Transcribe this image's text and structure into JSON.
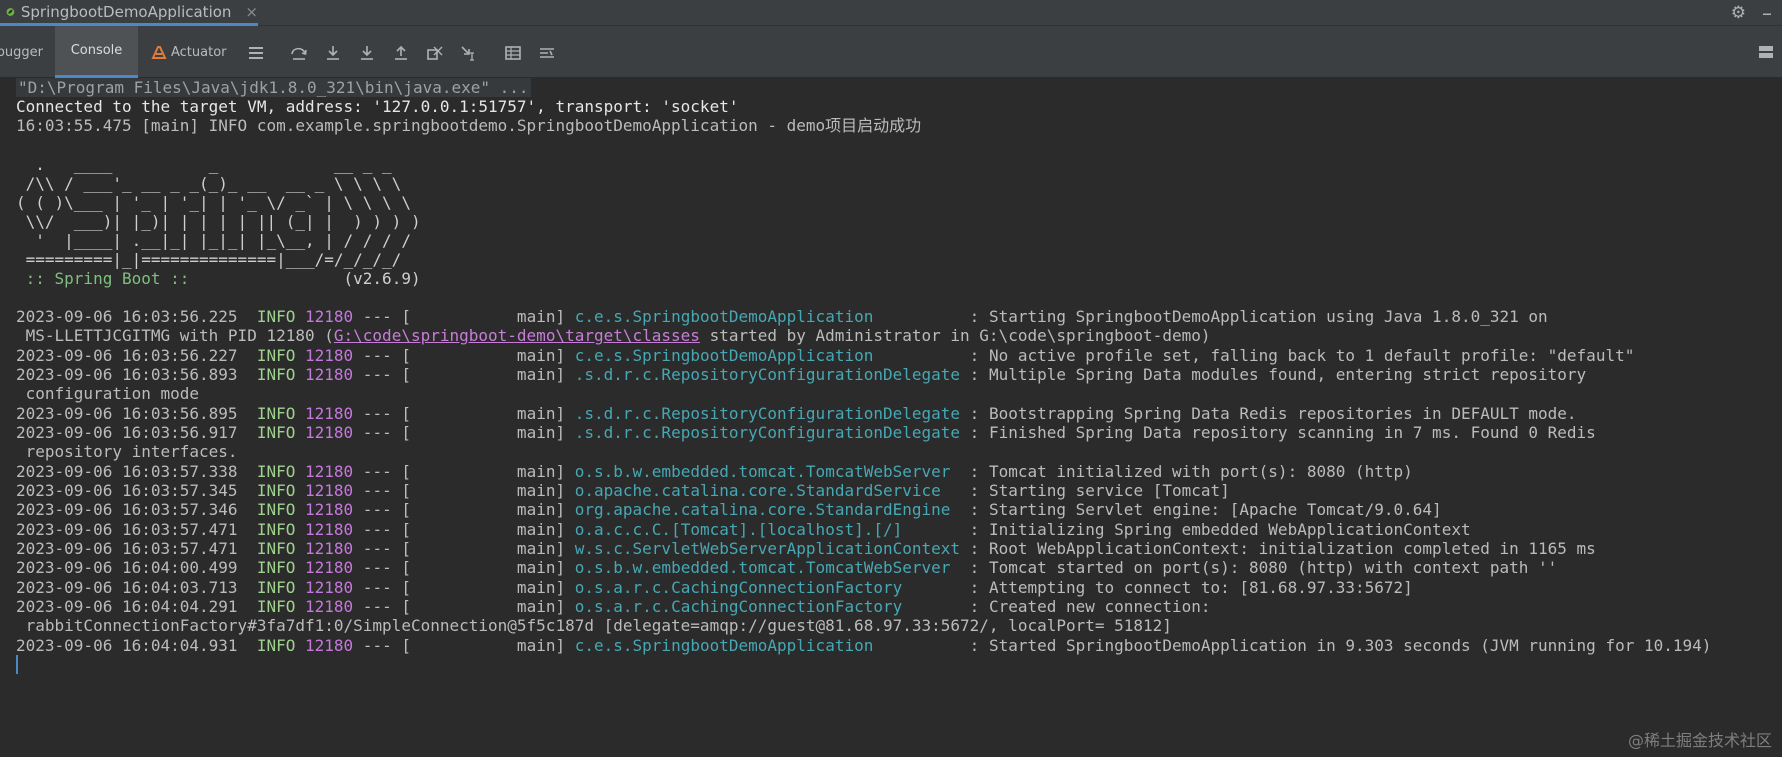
{
  "run_tab": {
    "title": "SpringbootDemoApplication",
    "close": "×"
  },
  "toolbar": {
    "debugger_label": "bugger",
    "console_label": "Console",
    "actuator_label": "Actuator"
  },
  "icons": [
    "spring-app-icon",
    "settings-gear-icon",
    "minimize-icon",
    "actuator-icon",
    "menu-icon",
    "step-over-icon",
    "step-into-icon",
    "force-step-into-icon",
    "step-out-icon",
    "drop-frame-icon",
    "run-to-cursor-icon",
    "evaluate-expression-icon",
    "trace-icon",
    "layout-icon"
  ],
  "colors": {
    "background": "#2b2b2b",
    "toolbar": "#3c3f41",
    "accent": "#4a88c7",
    "info": "#9fd18f",
    "pid": "#c678dd",
    "logger": "#46a8b4",
    "link": "#c77dd8"
  },
  "console": {
    "header": [
      "\"D:\\Program Files\\Java\\jdk1.8.0_321\\bin\\java.exe\" ...",
      "Connected to the target VM, address: '127.0.0.1:51757', transport: 'socket'",
      "16:03:55.475 [main] INFO com.example.springbootdemo.SpringbootDemoApplication - demo项目启动成功"
    ],
    "banner": [
      "  .   ____          _            __ _ _",
      " /\\\\ / ___'_ __ _ _(_)_ __  __ _ \\ \\ \\ \\",
      "( ( )\\___ | '_ | '_| | '_ \\/ _` | \\ \\ \\ \\",
      " \\\\/  ___)| |_)| | | | | || (_| |  ) ) ) )",
      "  '  |____| .__|_| |_|_| |_\\__, | / / / /",
      " =========|_|==============|___/=/_/_/_/"
    ],
    "spring_boot": {
      "label": " :: Spring Boot :: ",
      "version": "               (v2.6.9)"
    },
    "log_rows": [
      {
        "ts": "2023-09-06 16:03:56.225",
        "level": "INFO",
        "pid": "12180",
        "thread": " --- [           main] ",
        "logger": "c.e.s.SpringbootDemoApplication         ",
        "message": " : Starting SpringbootDemoApplication using Java 1.8.0_321 on"
      },
      {
        "ts": "2023-09-06 16:03:56.227",
        "level": "INFO",
        "pid": "12180",
        "thread": " --- [           main] ",
        "logger": "c.e.s.SpringbootDemoApplication         ",
        "message": " : No active profile set, falling back to 1 default profile: \"default\""
      },
      {
        "ts": "2023-09-06 16:03:56.893",
        "level": "INFO",
        "pid": "12180",
        "thread": " --- [           main] ",
        "logger": ".s.d.r.c.RepositoryConfigurationDelegate",
        "message": " : Multiple Spring Data modules found, entering strict repository",
        "cont": " configuration mode"
      },
      {
        "ts": "2023-09-06 16:03:56.895",
        "level": "INFO",
        "pid": "12180",
        "thread": " --- [           main] ",
        "logger": ".s.d.r.c.RepositoryConfigurationDelegate",
        "message": " : Bootstrapping Spring Data Redis repositories in DEFAULT mode."
      },
      {
        "ts": "2023-09-06 16:03:56.917",
        "level": "INFO",
        "pid": "12180",
        "thread": " --- [           main] ",
        "logger": ".s.d.r.c.RepositoryConfigurationDelegate",
        "message": " : Finished Spring Data repository scanning in 7 ms. Found 0 Redis",
        "cont": " repository interfaces."
      },
      {
        "ts": "2023-09-06 16:03:57.338",
        "level": "INFO",
        "pid": "12180",
        "thread": " --- [           main] ",
        "logger": "o.s.b.w.embedded.tomcat.TomcatWebServer ",
        "message": " : Tomcat initialized with port(s): 8080 (http)"
      },
      {
        "ts": "2023-09-06 16:03:57.345",
        "level": "INFO",
        "pid": "12180",
        "thread": " --- [           main] ",
        "logger": "o.apache.catalina.core.StandardService  ",
        "message": " : Starting service [Tomcat]"
      },
      {
        "ts": "2023-09-06 16:03:57.346",
        "level": "INFO",
        "pid": "12180",
        "thread": " --- [           main] ",
        "logger": "org.apache.catalina.core.StandardEngine ",
        "message": " : Starting Servlet engine: [Apache Tomcat/9.0.64]"
      },
      {
        "ts": "2023-09-06 16:03:57.471",
        "level": "INFO",
        "pid": "12180",
        "thread": " --- [           main] ",
        "logger": "o.a.c.c.C.[Tomcat].[localhost].[/]      ",
        "message": " : Initializing Spring embedded WebApplicationContext"
      },
      {
        "ts": "2023-09-06 16:03:57.471",
        "level": "INFO",
        "pid": "12180",
        "thread": " --- [           main] ",
        "logger": "w.s.c.ServletWebServerApplicationContext",
        "message": " : Root WebApplicationContext: initialization completed in 1165 ms"
      },
      {
        "ts": "2023-09-06 16:04:00.499",
        "level": "INFO",
        "pid": "12180",
        "thread": " --- [           main] ",
        "logger": "o.s.b.w.embedded.tomcat.TomcatWebServer ",
        "message": " : Tomcat started on port(s): 8080 (http) with context path ''"
      },
      {
        "ts": "2023-09-06 16:04:03.713",
        "level": "INFO",
        "pid": "12180",
        "thread": " --- [           main] ",
        "logger": "o.s.a.r.c.CachingConnectionFactory      ",
        "message": " : Attempting to connect to: [81.68.97.33:5672]"
      },
      {
        "ts": "2023-09-06 16:04:04.291",
        "level": "INFO",
        "pid": "12180",
        "thread": " --- [           main] ",
        "logger": "o.s.a.r.c.CachingConnectionFactory      ",
        "message": " : Created new connection:",
        "cont": " rabbitConnectionFactory#3fa7df1:0/SimpleConnection@5f5c187d [delegate=amqp://guest@81.68.97.33:5672/, localPort= 51812]"
      },
      {
        "ts": "2023-09-06 16:04:04.931",
        "level": "INFO",
        "pid": "12180",
        "thread": " --- [           main] ",
        "logger": "c.e.s.SpringbootDemoApplication         ",
        "message": " : Started SpringbootDemoApplication in 9.303 seconds (JVM running for 10.194)"
      }
    ],
    "row1_cont": {
      "prefix": " MS-LLETTJCGITMG with PID 12180 (",
      "link": "G:\\code\\springboot-demo\\target\\classes",
      "suffix": " started by Administrator in G:\\code\\springboot-demo)"
    }
  },
  "watermark": "@稀土掘金技术社区"
}
